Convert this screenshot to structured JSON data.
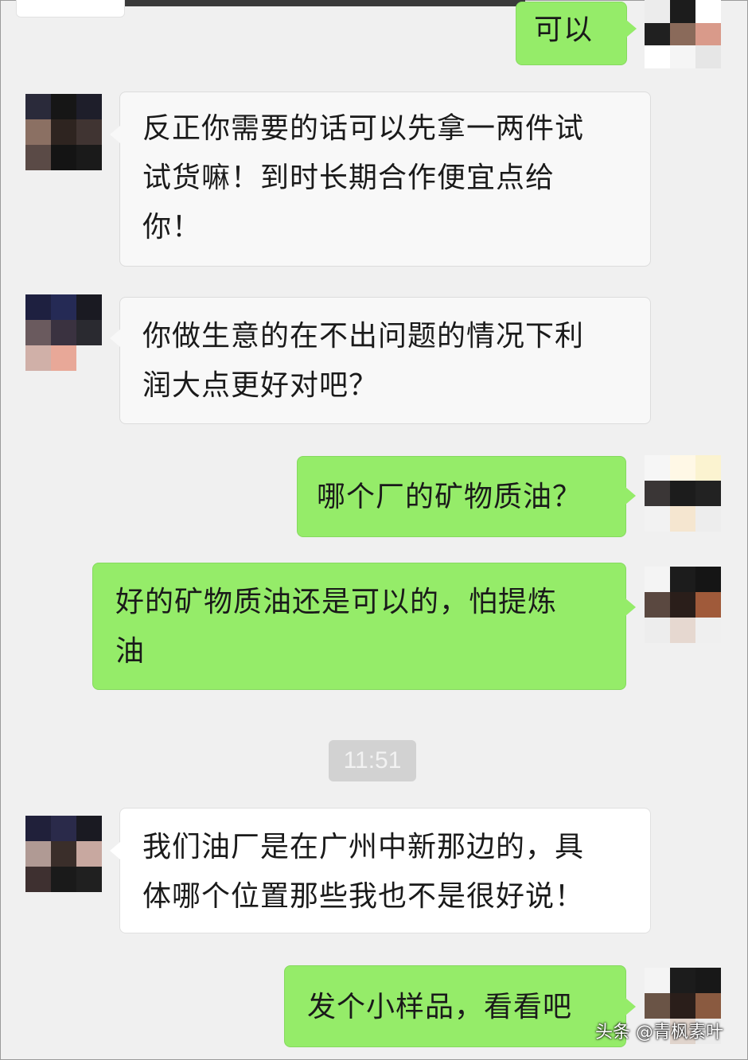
{
  "messages": [
    {
      "id": "m1",
      "side": "out",
      "text": "可以"
    },
    {
      "id": "m2",
      "side": "in",
      "text": "反正你需要的话可以先拿一两件试\n试货嘛！到时长期合作便宜点给\n你！"
    },
    {
      "id": "m3",
      "side": "in",
      "text": "你做生意的在不出问题的情况下利\n润大点更好对吧？"
    },
    {
      "id": "m4",
      "side": "out",
      "text": "哪个厂的矿物质油？"
    },
    {
      "id": "m5",
      "side": "out",
      "text": "好的矿物质油还是可以的，怕提炼\n油"
    },
    {
      "id": "m6",
      "side": "in",
      "text": "我们油厂是在广州中新那边的，具\n体哪个位置那些我也不是很好说！"
    },
    {
      "id": "m7",
      "side": "out",
      "text": "发个小样品，看看吧"
    }
  ],
  "timestamp": "11:51",
  "watermark": "头条 @青枫素叶",
  "colors": {
    "out_bubble": "#95ec69",
    "in_bubble": "#f8f8f8",
    "background": "#f0f0f0"
  },
  "icons": {
    "contact_avatar": "contact-avatar-icon",
    "user_avatar": "user-avatar-icon"
  }
}
